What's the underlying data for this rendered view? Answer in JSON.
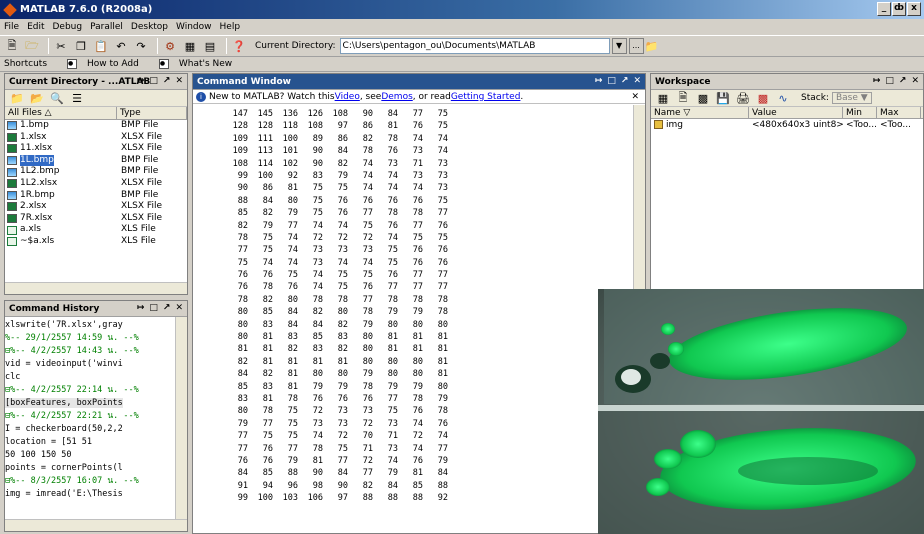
{
  "window": {
    "title": "MATLAB 7.6.0 (R2008a)",
    "controls": [
      "_",
      "ȸ",
      "x"
    ]
  },
  "menu": [
    "File",
    "Edit",
    "Debug",
    "Parallel",
    "Desktop",
    "Window",
    "Help"
  ],
  "toolbar": {
    "current_directory_label": "Current Directory:",
    "current_directory_value": "C:\\Users\\pentagon_ou\\Documents\\MATLAB",
    "browse_label": "..."
  },
  "shortcuts": [
    "Shortcuts",
    "How to Add",
    "What's New"
  ],
  "current_directory_panel": {
    "title": "Current Directory - ...ATLAB",
    "columns": [
      "All Files △",
      "Type"
    ],
    "files": [
      {
        "name": "1.bmp",
        "type": "BMP File",
        "icon": "bmp-file-icon"
      },
      {
        "name": "1.xlsx",
        "type": "XLSX File",
        "icon": "xlsx-file-icon"
      },
      {
        "name": "11.xlsx",
        "type": "XLSX File",
        "icon": "xlsx-file-icon"
      },
      {
        "name": "1L.bmp",
        "type": "BMP File",
        "icon": "bmp-file-icon",
        "selected": true
      },
      {
        "name": "1L2.bmp",
        "type": "BMP File",
        "icon": "bmp-file-icon"
      },
      {
        "name": "1L2.xlsx",
        "type": "XLSX File",
        "icon": "xlsx-file-icon"
      },
      {
        "name": "1R.bmp",
        "type": "BMP File",
        "icon": "bmp-file-icon"
      },
      {
        "name": "2.xlsx",
        "type": "XLSX File",
        "icon": "xlsx-file-icon"
      },
      {
        "name": "7R.xlsx",
        "type": "XLSX File",
        "icon": "xlsx-file-icon"
      },
      {
        "name": "a.xls",
        "type": "XLS File",
        "icon": "xls-file-icon"
      },
      {
        "name": "~$a.xls",
        "type": "XLS File",
        "icon": "xls-file-icon"
      }
    ]
  },
  "command_history": {
    "title": "Command History",
    "lines": [
      {
        "text": "    xlswrite('7R.xlsx',gray",
        "kind": "cmd"
      },
      {
        "text": " %-- 29/1/2557 14:59 น. --%",
        "kind": "date"
      },
      {
        "text": "⊟%-- 4/2/2557 14:43 น. --%",
        "kind": "date"
      },
      {
        "text": "    vid = videoinput('winvi",
        "kind": "cmd"
      },
      {
        "text": "    clc",
        "kind": "cmd"
      },
      {
        "text": "⊟%-- 4/2/2557 22:14 น. --%",
        "kind": "date"
      },
      {
        "text": "    [boxFeatures, boxPoints",
        "kind": "cmd",
        "selected": true
      },
      {
        "text": "⊟%-- 4/2/2557 22:21 น. --%",
        "kind": "date"
      },
      {
        "text": "    I = checkerboard(50,2,2",
        "kind": "cmd"
      },
      {
        "text": "    location = [51    51",
        "kind": "cmd"
      },
      {
        "text": "    50   100   150    50",
        "kind": "cmd"
      },
      {
        "text": "    points = cornerPoints(l",
        "kind": "cmd"
      },
      {
        "text": "⊟%-- 8/3/2557 16:07 น. --%",
        "kind": "date"
      },
      {
        "text": "    img = imread('E:\\Thesis",
        "kind": "cmd"
      }
    ]
  },
  "command_window": {
    "title": "Command Window",
    "info_prefix": "New to MATLAB? Watch this ",
    "link_video": "Video",
    "info_mid": ", see ",
    "link_demos": "Demos",
    "info_mid2": ", or read ",
    "link_getting_started": "Getting Started",
    "info_suffix": ".",
    "matrix": [
      [
        147,
        145,
        136,
        126,
        108,
        90,
        84,
        77,
        75
      ],
      [
        128,
        128,
        118,
        108,
        97,
        86,
        81,
        76,
        75
      ],
      [
        109,
        111,
        100,
        89,
        86,
        82,
        78,
        74,
        74
      ],
      [
        109,
        113,
        101,
        90,
        84,
        78,
        76,
        73,
        74
      ],
      [
        108,
        114,
        102,
        90,
        82,
        74,
        73,
        71,
        73
      ],
      [
        99,
        100,
        92,
        83,
        79,
        74,
        74,
        73,
        73
      ],
      [
        90,
        86,
        81,
        75,
        75,
        74,
        74,
        74,
        73
      ],
      [
        88,
        84,
        80,
        75,
        76,
        76,
        76,
        76,
        75
      ],
      [
        85,
        82,
        79,
        75,
        76,
        77,
        78,
        78,
        77
      ],
      [
        82,
        79,
        77,
        74,
        74,
        75,
        76,
        77,
        76
      ],
      [
        78,
        75,
        74,
        72,
        72,
        72,
        74,
        75,
        75
      ],
      [
        77,
        75,
        74,
        73,
        73,
        73,
        75,
        76,
        76
      ],
      [
        75,
        74,
        74,
        73,
        74,
        74,
        75,
        76,
        76
      ],
      [
        76,
        76,
        75,
        74,
        75,
        75,
        76,
        77,
        77
      ],
      [
        76,
        78,
        76,
        74,
        75,
        76,
        77,
        77,
        77
      ],
      [
        78,
        82,
        80,
        78,
        78,
        77,
        78,
        78,
        78
      ],
      [
        80,
        85,
        84,
        82,
        80,
        78,
        79,
        79,
        78
      ],
      [
        80,
        83,
        84,
        84,
        82,
        79,
        80,
        80,
        80
      ],
      [
        80,
        81,
        83,
        85,
        83,
        80,
        81,
        81,
        81
      ],
      [
        81,
        81,
        82,
        83,
        82,
        80,
        81,
        81,
        81
      ],
      [
        82,
        81,
        81,
        81,
        81,
        80,
        80,
        80,
        81
      ],
      [
        84,
        82,
        81,
        80,
        80,
        79,
        80,
        80,
        81
      ],
      [
        85,
        83,
        81,
        79,
        79,
        78,
        79,
        79,
        80
      ],
      [
        83,
        81,
        78,
        76,
        76,
        76,
        77,
        78,
        79
      ],
      [
        80,
        78,
        75,
        72,
        73,
        73,
        75,
        76,
        78
      ],
      [
        79,
        77,
        75,
        73,
        73,
        72,
        73,
        74,
        76
      ],
      [
        77,
        75,
        75,
        74,
        72,
        70,
        71,
        72,
        74
      ],
      [
        77,
        76,
        77,
        78,
        75,
        71,
        73,
        74,
        77
      ],
      [
        76,
        76,
        79,
        81,
        77,
        72,
        74,
        76,
        79
      ],
      [
        84,
        85,
        88,
        90,
        84,
        77,
        79,
        81,
        84
      ],
      [
        91,
        94,
        96,
        98,
        90,
        82,
        84,
        85,
        88
      ],
      [
        99,
        100,
        103,
        106,
        97,
        88,
        88,
        88,
        92
      ]
    ]
  },
  "workspace": {
    "title": "Workspace",
    "stack_label": "Stack:",
    "stack_value": "Base",
    "columns": [
      "Name ▽",
      "Value",
      "Min",
      "Max"
    ],
    "variables": [
      {
        "name": "img",
        "value": "<480x640x3 uint8>",
        "min": "<Too...",
        "max": "<Too..."
      }
    ]
  },
  "colors": {
    "active_header": "#27538f",
    "date_green": "#008000",
    "link_blue": "#0000ee",
    "selection": "#316ac5"
  }
}
